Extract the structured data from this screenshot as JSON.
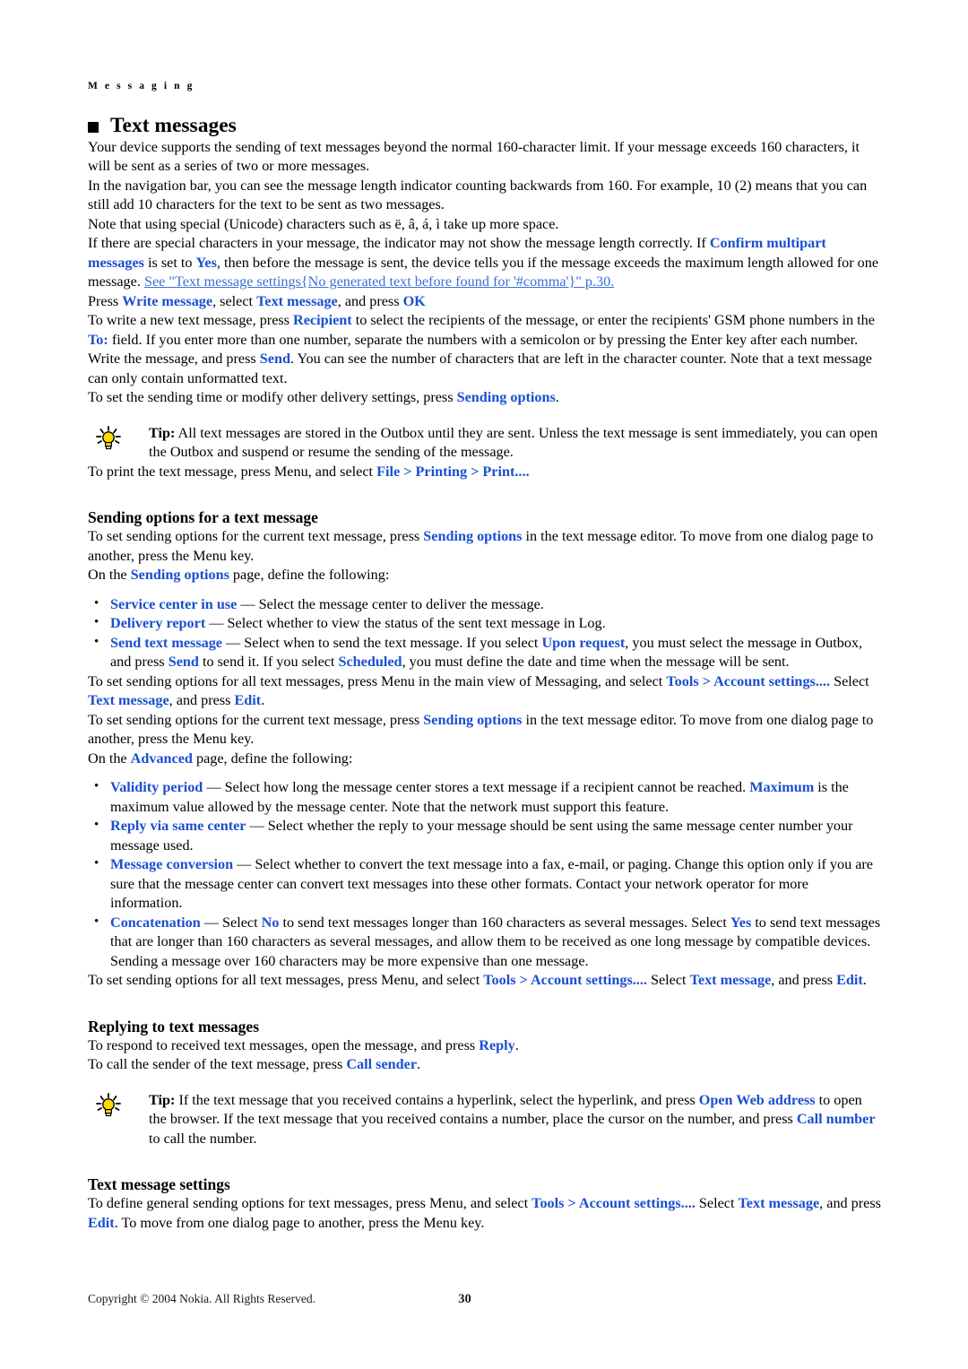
{
  "running_head": "M e s s a g i n g",
  "chapter_title": "Text messages",
  "intro": {
    "p1": "Your device supports the sending of text messages beyond the normal 160-character limit. If your message exceeds 160 characters, it will be sent as a series of two or more messages.",
    "p2": "In the navigation bar, you can see the message length indicator counting backwards from 160. For example, 10 (2) means that you can still add 10 characters for the text to be sent as two messages.",
    "p3": "Note that using special (Unicode) characters such as ë, â, á, ì take up more space.",
    "p4_a": "If there are special characters in your message, the indicator may not show the message length correctly. If ",
    "p4_term1": "Confirm multipart messages",
    "p4_b": " is set to ",
    "p4_term2": "Yes",
    "p4_c": ", then before the message is sent, the device tells you if the message exceeds the maximum length allowed for one message. ",
    "p4_xref": "See \"Text message settings{No generated text before found for '#comma'}\" p.30.",
    "p5_a": "Press ",
    "p5_term1": "Write message",
    "p5_b": ", select ",
    "p5_term2": "Text message",
    "p5_c": ", and press ",
    "p5_term3": "OK"
  },
  "write": {
    "a": "To write a new text message, press ",
    "term1": "Recipient",
    "b": " to select the recipients of the message, or enter the recipients' GSM phone numbers in the ",
    "term2": "To:",
    "c": " field. If you enter more than one number, separate the numbers with a semicolon or by pressing the Enter key after each number. Write the message, and press ",
    "term3": "Send",
    "d": ". You can see the number of characters that are left in the character counter. Note that a text message can only contain unformatted text.",
    "p2_a": "To set the sending time or modify other delivery settings, press ",
    "p2_term": "Sending options",
    "p2_b": "."
  },
  "tip1": {
    "label": "Tip:",
    "text": " All text messages are stored in the Outbox until they are sent. Unless the text message is sent immediately, you can open the Outbox and suspend or resume the sending of the message."
  },
  "print": {
    "a": "To print the text message, press Menu, and select ",
    "term1": "File",
    "sep1": " > ",
    "term2": "Printing",
    "sep2": " > ",
    "term3": "Print...."
  },
  "sending_options_section": {
    "heading": "Sending options for a text message",
    "p1_a": "To set sending options for the current text message, press ",
    "p1_term": "Sending options",
    "p1_b": " in the text message editor. To move from one dialog page to another, press the Menu key.",
    "p2_a": "On the ",
    "p2_term": "Sending options",
    "p2_b": " page, define the following:",
    "bullets": [
      {
        "term": "Service center in use",
        "rest": " — Select the message center to deliver the message."
      },
      {
        "term": "Delivery report",
        "rest": " — Select whether to view the status of the sent text message in Log."
      },
      {
        "term": "Send text message",
        "rest_a": " — Select when to send the text message. If you select ",
        "rest_term1": "Upon request",
        "rest_b": ", you must select the message in Outbox, and press ",
        "rest_term2": "Send",
        "rest_c": " to send it. If you select ",
        "rest_term3": "Scheduled",
        "rest_d": ", you must define the date and time when the message will be sent."
      }
    ],
    "p3_a": "To set sending options for all text messages, press Menu in the main view of Messaging, and select ",
    "p3_term1": "Tools",
    "p3_sep": " > ",
    "p3_term2": "Account settings....",
    "p3_b": " Select ",
    "p3_term3": "Text message",
    "p3_c": ", and press ",
    "p3_term4": "Edit",
    "p3_d": "."
  },
  "advanced_section": {
    "p1_a": "To set sending options for the current text message, press ",
    "p1_term": "Sending options",
    "p1_b": " in the text message editor. To move from one dialog page to another, press the Menu key.",
    "p2_a": "On the ",
    "p2_term": "Advanced",
    "p2_b": " page, define the following:",
    "bullets": [
      {
        "term": "Validity period",
        "rest_a": " — Select how long the message center stores a text message if a recipient cannot be reached. ",
        "rest_term1": "Maximum",
        "rest_b": " is the maximum value allowed by the message center. Note that the network must support this feature."
      },
      {
        "term": "Reply via same center",
        "rest_a": " — Select whether the reply to your message should be sent using the same message center number your message used."
      },
      {
        "term": "Message conversion",
        "rest_a": " — Select whether to convert the text message into a fax, e-mail, or paging. Change this option only if you are sure that the message center can convert text messages into these other formats. Contact your network operator for more information."
      },
      {
        "term": "Concatenation",
        "rest_a": " — Select ",
        "rest_term1": "No",
        "rest_b": " to send text messages longer than 160 characters as several messages. Select ",
        "rest_term2": "Yes",
        "rest_c": " to send text messages that are longer than 160 characters as several messages, and allow them to be received as one long message by compatible devices. Sending a message over 160 characters may be more expensive than one message."
      }
    ],
    "p3_a": "To set sending options for all text messages, press Menu, and select ",
    "p3_term1": "Tools",
    "p3_sep": " > ",
    "p3_term2": "Account settings....",
    "p3_b": " Select ",
    "p3_term3": "Text message",
    "p3_c": ", and press ",
    "p3_term4": "Edit",
    "p3_d": "."
  },
  "replying_section": {
    "heading": "Replying to text messages",
    "p1_a": "To respond to received text messages, open the message, and press ",
    "p1_term": "Reply",
    "p1_b": ".",
    "p2_a": "To call the sender of the text message, press ",
    "p2_term": "Call sender",
    "p2_b": ".",
    "tip_label": "Tip:",
    "tip_a": " If the text message that you received contains a hyperlink, select the hyperlink, and press ",
    "tip_term1": "Open Web address",
    "tip_b": " to open the browser. If the text message that you received contains a number, place the cursor on the number, and press ",
    "tip_term2": "Call number",
    "tip_c": " to call the number."
  },
  "settings_section": {
    "heading": "Text message settings",
    "p1_a": "To define general sending options for text messages, press Menu, and select ",
    "p1_term1": "Tools",
    "p1_sep": " > ",
    "p1_term2": "Account settings....",
    "p1_b": " Select ",
    "p1_term3": "Text message",
    "p1_c": ", and press ",
    "p1_term4": "Edit",
    "p1_d": ". To move from one dialog page to another, press the Menu key."
  },
  "footer": {
    "copyright": "Copyright © 2004 Nokia. All Rights Reserved.",
    "page_number": "30"
  },
  "colors": {
    "ui_term_blue": "#1a4fd0",
    "xref_blue": "#3a6fd8",
    "tip_bulb_yellow": "#ffd900"
  }
}
